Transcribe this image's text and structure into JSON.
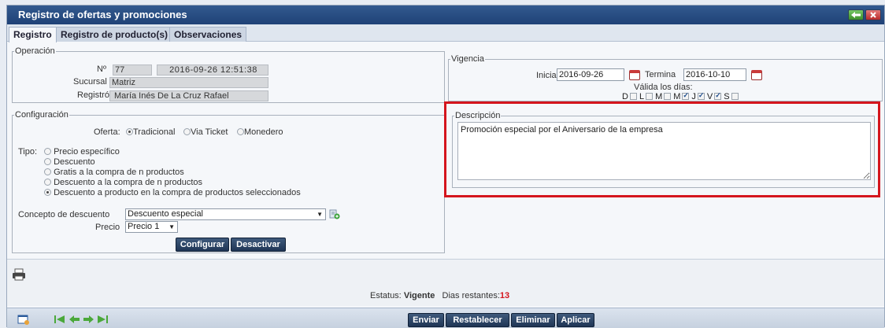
{
  "window": {
    "title": "Registro de ofertas y promociones"
  },
  "tabs": [
    "Registro",
    "Registro de producto(s)",
    "Observaciones"
  ],
  "operacion": {
    "legend": "Operación",
    "no_label": "Nº",
    "no_value": "77",
    "fecha": "2016-09-26 12:51:38",
    "sucursal_label": "Sucursal",
    "sucursal_value": "Matriz",
    "registro_label": "Registró",
    "registro_value": "María Inés De La Cruz Rafael"
  },
  "configuracion": {
    "legend": "Configuración",
    "oferta_label": "Oferta:",
    "oferta_options": [
      "Tradicional",
      "Via Ticket",
      "Monedero"
    ],
    "oferta_selected": "Tradicional",
    "tipo_label": "Tipo:",
    "tipo_options": [
      "Precio específico",
      "Descuento",
      "Gratis a la compra de n productos",
      "Descuento a la compra de n productos",
      "Descuento a producto en la compra de productos seleccionados"
    ],
    "tipo_selected": "Descuento a producto en la compra de productos seleccionados",
    "concepto_label": "Concepto de descuento",
    "concepto_value": "Descuento especial",
    "precio_label": "Precio",
    "precio_value": "Precio 1",
    "configurar_label": "Configurar",
    "desactivar_label": "Desactivar"
  },
  "vigencia": {
    "legend": "Vigencia",
    "inicia_label": "Inicia",
    "inicia_value": "2016-09-26",
    "termina_label": "Termina",
    "termina_value": "2016-10-10",
    "valida_label": "Válida los días:",
    "days": [
      {
        "label": "D",
        "checked": false
      },
      {
        "label": "L",
        "checked": false
      },
      {
        "label": "M",
        "checked": false
      },
      {
        "label": "M",
        "checked": true
      },
      {
        "label": "J",
        "checked": true
      },
      {
        "label": "V",
        "checked": true
      },
      {
        "label": "S",
        "checked": false
      }
    ]
  },
  "descripcion": {
    "legend": "Descripción",
    "value": "Promoción especial por el Aniversario de la empresa"
  },
  "status": {
    "estatus_label": "Estatus:",
    "estatus_value": "Vigente",
    "dias_label": "Dias restantes:",
    "dias_value": "13",
    "dias_color": "#d4151d"
  },
  "footer": {
    "buttons": [
      "Enviar",
      "Restablecer",
      "Eliminar",
      "Aplicar"
    ]
  },
  "colors": {
    "titlebar": "#1f4277",
    "highlight": "#d4151d"
  },
  "icons": [
    "back-arrow-icon",
    "close-icon",
    "calendar-icon",
    "add-concept-icon",
    "printer-icon",
    "new-record-icon",
    "nav-first-icon",
    "nav-prev-icon",
    "nav-next-icon",
    "nav-last-icon"
  ]
}
